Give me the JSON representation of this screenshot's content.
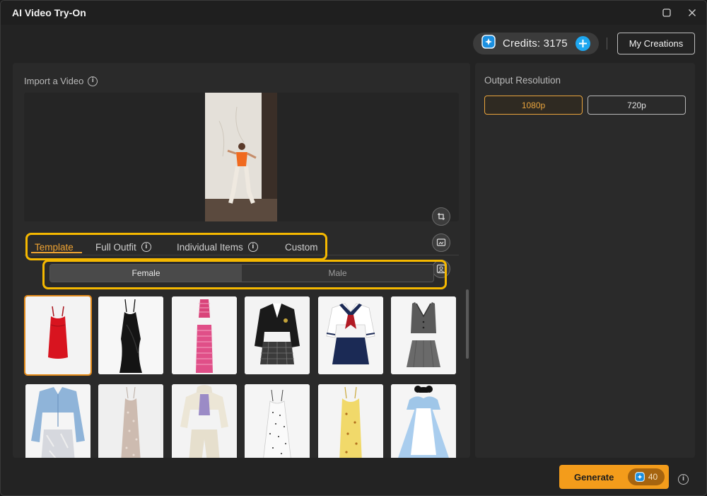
{
  "window": {
    "title": "AI Video Try-On"
  },
  "header": {
    "credits_text": "Credits: 3175",
    "my_creations_label": "My Creations"
  },
  "import": {
    "label": "Import a Video"
  },
  "tabs": [
    {
      "label": "Template",
      "active": true,
      "info": false
    },
    {
      "label": "Full Outfit",
      "active": false,
      "info": true
    },
    {
      "label": "Individual Items",
      "active": false,
      "info": true
    },
    {
      "label": "Custom",
      "active": false,
      "info": false
    }
  ],
  "gender": {
    "options": [
      "Female",
      "Male"
    ],
    "selected": "Female"
  },
  "garments": [
    {
      "icon": "red-mini-dress-icon",
      "selected": true
    },
    {
      "icon": "black-slip-dress-icon",
      "selected": false
    },
    {
      "icon": "pink-striped-set-icon",
      "selected": false
    },
    {
      "icon": "black-blazer-plaid-skirt-icon",
      "selected": false
    },
    {
      "icon": "sailor-uniform-icon",
      "selected": false
    },
    {
      "icon": "grey-vest-skirt-icon",
      "selected": false
    },
    {
      "icon": "blue-cardigan-silver-skirt-icon",
      "selected": false
    },
    {
      "icon": "sequin-slip-dress-icon",
      "selected": false
    },
    {
      "icon": "cream-hoodie-set-icon",
      "selected": false
    },
    {
      "icon": "white-polka-dress-icon",
      "selected": false
    },
    {
      "icon": "yellow-floral-dress-icon",
      "selected": false
    },
    {
      "icon": "blue-apron-dress-icon",
      "selected": false
    }
  ],
  "output": {
    "label": "Output Resolution",
    "options": [
      "1080p",
      "720p"
    ],
    "selected": "1080p"
  },
  "footer": {
    "generate_label": "Generate",
    "cost": "40"
  },
  "colors": {
    "accent": "#f39c1b",
    "tab_active": "#f0a433",
    "highlight": "#f5b800",
    "credit_blue": "#1ea7f0"
  }
}
